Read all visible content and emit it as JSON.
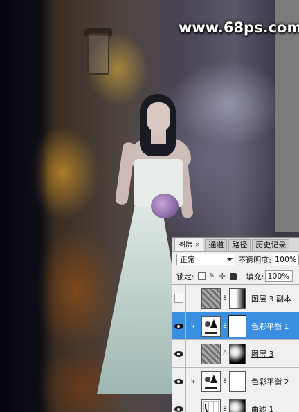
{
  "watermark": "www.68ps.com",
  "panel": {
    "tabs": [
      {
        "label": "图层",
        "close": "×"
      },
      {
        "label": "通道"
      },
      {
        "label": "路径"
      },
      {
        "label": "历史记录"
      }
    ],
    "blend_mode": "正常",
    "opacity_label": "不透明度:",
    "opacity_value": "100%",
    "lock_label": "锁定:",
    "fill_label": "填充:",
    "fill_value": "100%",
    "layers": [
      {
        "name": "图层 3 副本",
        "visible": false,
        "selected": false
      },
      {
        "name": "色彩平衡 1",
        "visible": true,
        "selected": true
      },
      {
        "name": "图层 3",
        "visible": true,
        "selected": false
      },
      {
        "name": "色彩平衡 2",
        "visible": true,
        "selected": false
      },
      {
        "name": "曲线 1",
        "visible": true,
        "selected": false
      }
    ]
  }
}
